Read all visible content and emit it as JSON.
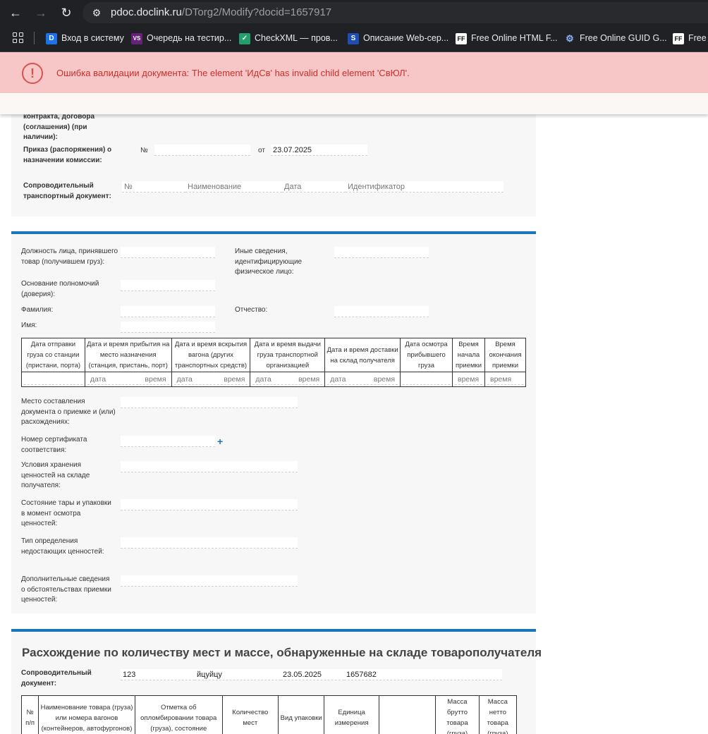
{
  "browser": {
    "url_host": "pdoc.doclink.ru",
    "url_path": "/DTorg2/Modify?docid=1657917",
    "bookmarks": [
      {
        "label": "Вход в систему",
        "icon": "D",
        "icon_color": "#1a73e8"
      },
      {
        "label": "Очередь на тестир...",
        "icon": "VS",
        "icon_color": "#68217a"
      },
      {
        "label": "CheckXML — пров...",
        "icon": "✓",
        "icon_color": "#22a06b"
      },
      {
        "label": "Описание Web-сер...",
        "icon": "S",
        "icon_color": "#1e4db7"
      },
      {
        "label": "Free Online HTML F...",
        "icon": "FF",
        "icon_color": "#111111"
      },
      {
        "label": "Free Online GUID G...",
        "icon": "⚙",
        "icon_color": "#3b6ea5"
      },
      {
        "label": "Free",
        "icon": "FF",
        "icon_color": "#111111"
      }
    ]
  },
  "alert": {
    "message": "Ошибка валидации документа: The element 'ИдСв' has invalid child element 'СвЮЛ'.",
    "icon": "exclamation-circle-icon",
    "color": "#d9534f"
  },
  "section1": {
    "contract_label": "контракта, договора (соглашения) (при наличии):",
    "order_label": "Приказ (распоряжения) о назначении комиссии:",
    "order_no_label": "№",
    "order_no": "",
    "order_from_label": "от",
    "order_date": "23.07.2025",
    "transport_doc_label": "Сопроводительный транспортный документ:",
    "transport_doc_no": "№",
    "transport_doc_name": "Наименование",
    "transport_doc_date": "Дата",
    "transport_doc_id": "Идентификатор"
  },
  "section2": {
    "position_label": "Должность лица, принявшего товар (получившем груз):",
    "other_info_label": "Иные сведения, идентифицирующие физическое лицо:",
    "authority_label": "Основание полномочий (доверия):",
    "surname_label": "Фамилия:",
    "patronymic_label": "Отчество:",
    "name_label": "Имя:",
    "dates_table": {
      "headers": [
        "Дата отправки груза со станции (пристани, порта)",
        "Дата и время прибытия на место назначения (станция, пристань, порт)",
        "Дата и время вскрытия вагона (других транспортных средств)",
        "Дата и время выдачи груза транспортной организацией",
        "Дата и время доставки на склад получателя",
        "Дата осмотра прибывшего груза",
        "Время начала приемки",
        "Время окончания приемки"
      ],
      "placeholder_date": "дата",
      "placeholder_time": "время"
    },
    "place_label": "Место составления документа о приемке и (или) расхождениях:",
    "cert_label": "Номер сертификата соответствия:",
    "storage_label": "Условия хранения ценностей на складе получателя:",
    "packaging_label": "Состояние тары и упаковки в момент осмотра ценностей:",
    "shortage_label": "Тип определения недостающих ценностей:",
    "extra_label": "Дополнительные сведения о обстоятельствах приемки ценностей:"
  },
  "section3": {
    "title": "Расхождение по количеству мест и массе, обнаруженные на складе товарополучателя",
    "transport_doc_label": "Сопроводительный документ:",
    "doc_no": "123",
    "doc_name": "йцуйцу",
    "doc_date": "23.05.2025",
    "doc_id": "1657682",
    "table_headers": [
      "№ п/п",
      "Наименование товара (груза) или номера вагонов (контейнеров, автофургонов)",
      "Отметка об опломбировании товара (груза), состояние",
      "Количество мест",
      "Вид упаковки",
      "Единица измерения",
      "",
      "Масса брутто товара (груза)",
      "Масса нетто товара (груза)"
    ]
  }
}
